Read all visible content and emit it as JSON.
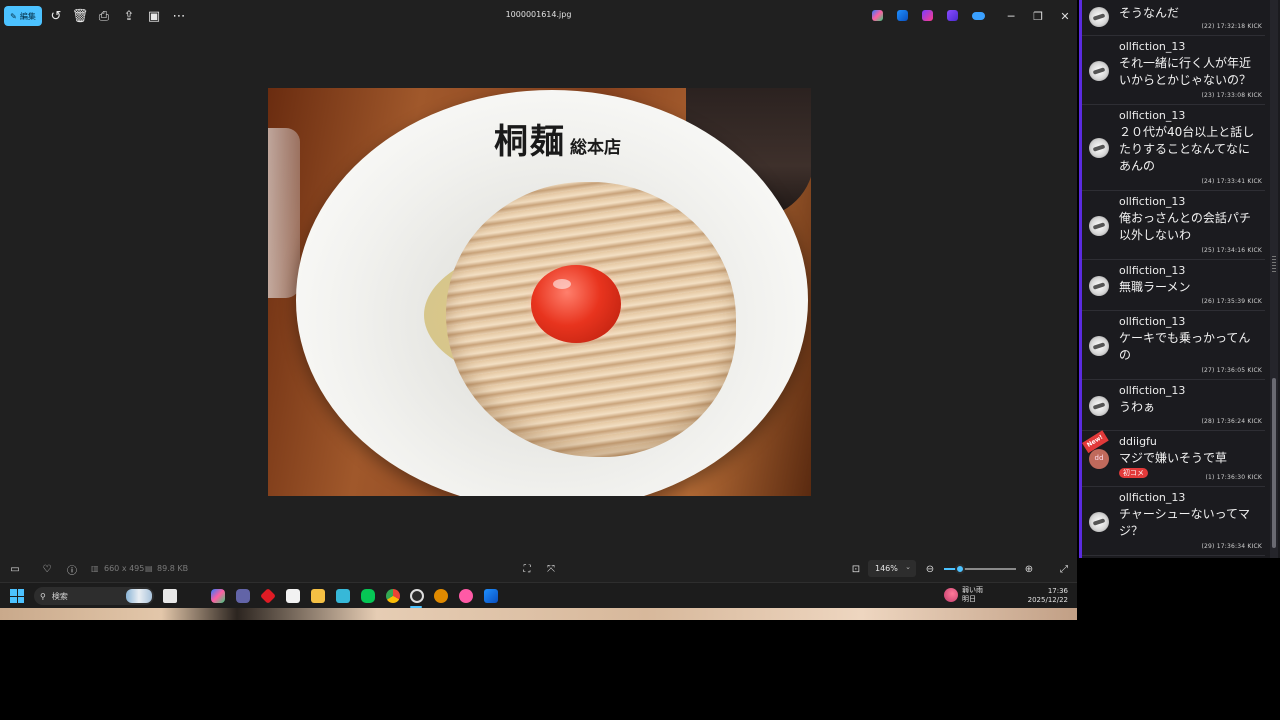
{
  "viewer": {
    "edit_label": "編集",
    "file_name": "1000001614.jpg",
    "dimensions": "660 x 495",
    "file_size": "89.8 KB",
    "zoom": "146%",
    "zoom_slider_fraction": 0.22,
    "photo": {
      "bowl_text_main": "桐麺",
      "bowl_text_sub": "総本店"
    }
  },
  "taskbar": {
    "search_placeholder": "検索",
    "weather_line1": "弱い雨",
    "weather_line2": "明日",
    "time": "17:36",
    "date": "2025/12/22"
  },
  "chat": {
    "messages": [
      {
        "user": "",
        "text": "そうなんだ",
        "meta": "(22)  17:32:18  KICK"
      },
      {
        "user": "ollfiction_13",
        "text": "それ一緒に行く人が年近いからとかじゃないの？",
        "meta": "(23)  17:33:08  KICK"
      },
      {
        "user": "ollfiction_13",
        "text": "２０代が40台以上と話したりすることなんてなにあんの",
        "meta": "(24)  17:33:41  KICK"
      },
      {
        "user": "ollfiction_13",
        "text": "俺おっさんとの会話パチ以外しないわ",
        "meta": "(25)  17:34:16  KICK"
      },
      {
        "user": "ollfiction_13",
        "text": "無職ラーメン",
        "meta": "(26)  17:35:39  KICK"
      },
      {
        "user": "ollfiction_13",
        "text": "ケーキでも乗っかってんの",
        "meta": "(27)  17:36:05  KICK"
      },
      {
        "user": "ollfiction_13",
        "text": "うわぁ",
        "meta": "(28)  17:36:24  KICK"
      },
      {
        "user": "ddiigfu",
        "avatar_initials": "dd",
        "badge": "New!",
        "tag": "初コメ",
        "text": "マジで嫌いそうで草",
        "meta": "(1)  17:36:30  KICK"
      },
      {
        "user": "ollfiction_13",
        "text": "チャーシューないってマジ？",
        "meta": "(29)  17:36:34  KICK"
      }
    ]
  },
  "colors": {
    "accent": "#4cc2ff",
    "chat_border": "#5b2be0",
    "new_badge": "#e23a3a"
  },
  "icons": [
    "edit-icon",
    "rotate-icon",
    "delete-icon",
    "print-icon",
    "share-icon",
    "slideshow-icon",
    "more-icon",
    "favorite-icon",
    "info-icon",
    "zoom-in-icon",
    "zoom-out-icon",
    "fullscreen-icon"
  ]
}
